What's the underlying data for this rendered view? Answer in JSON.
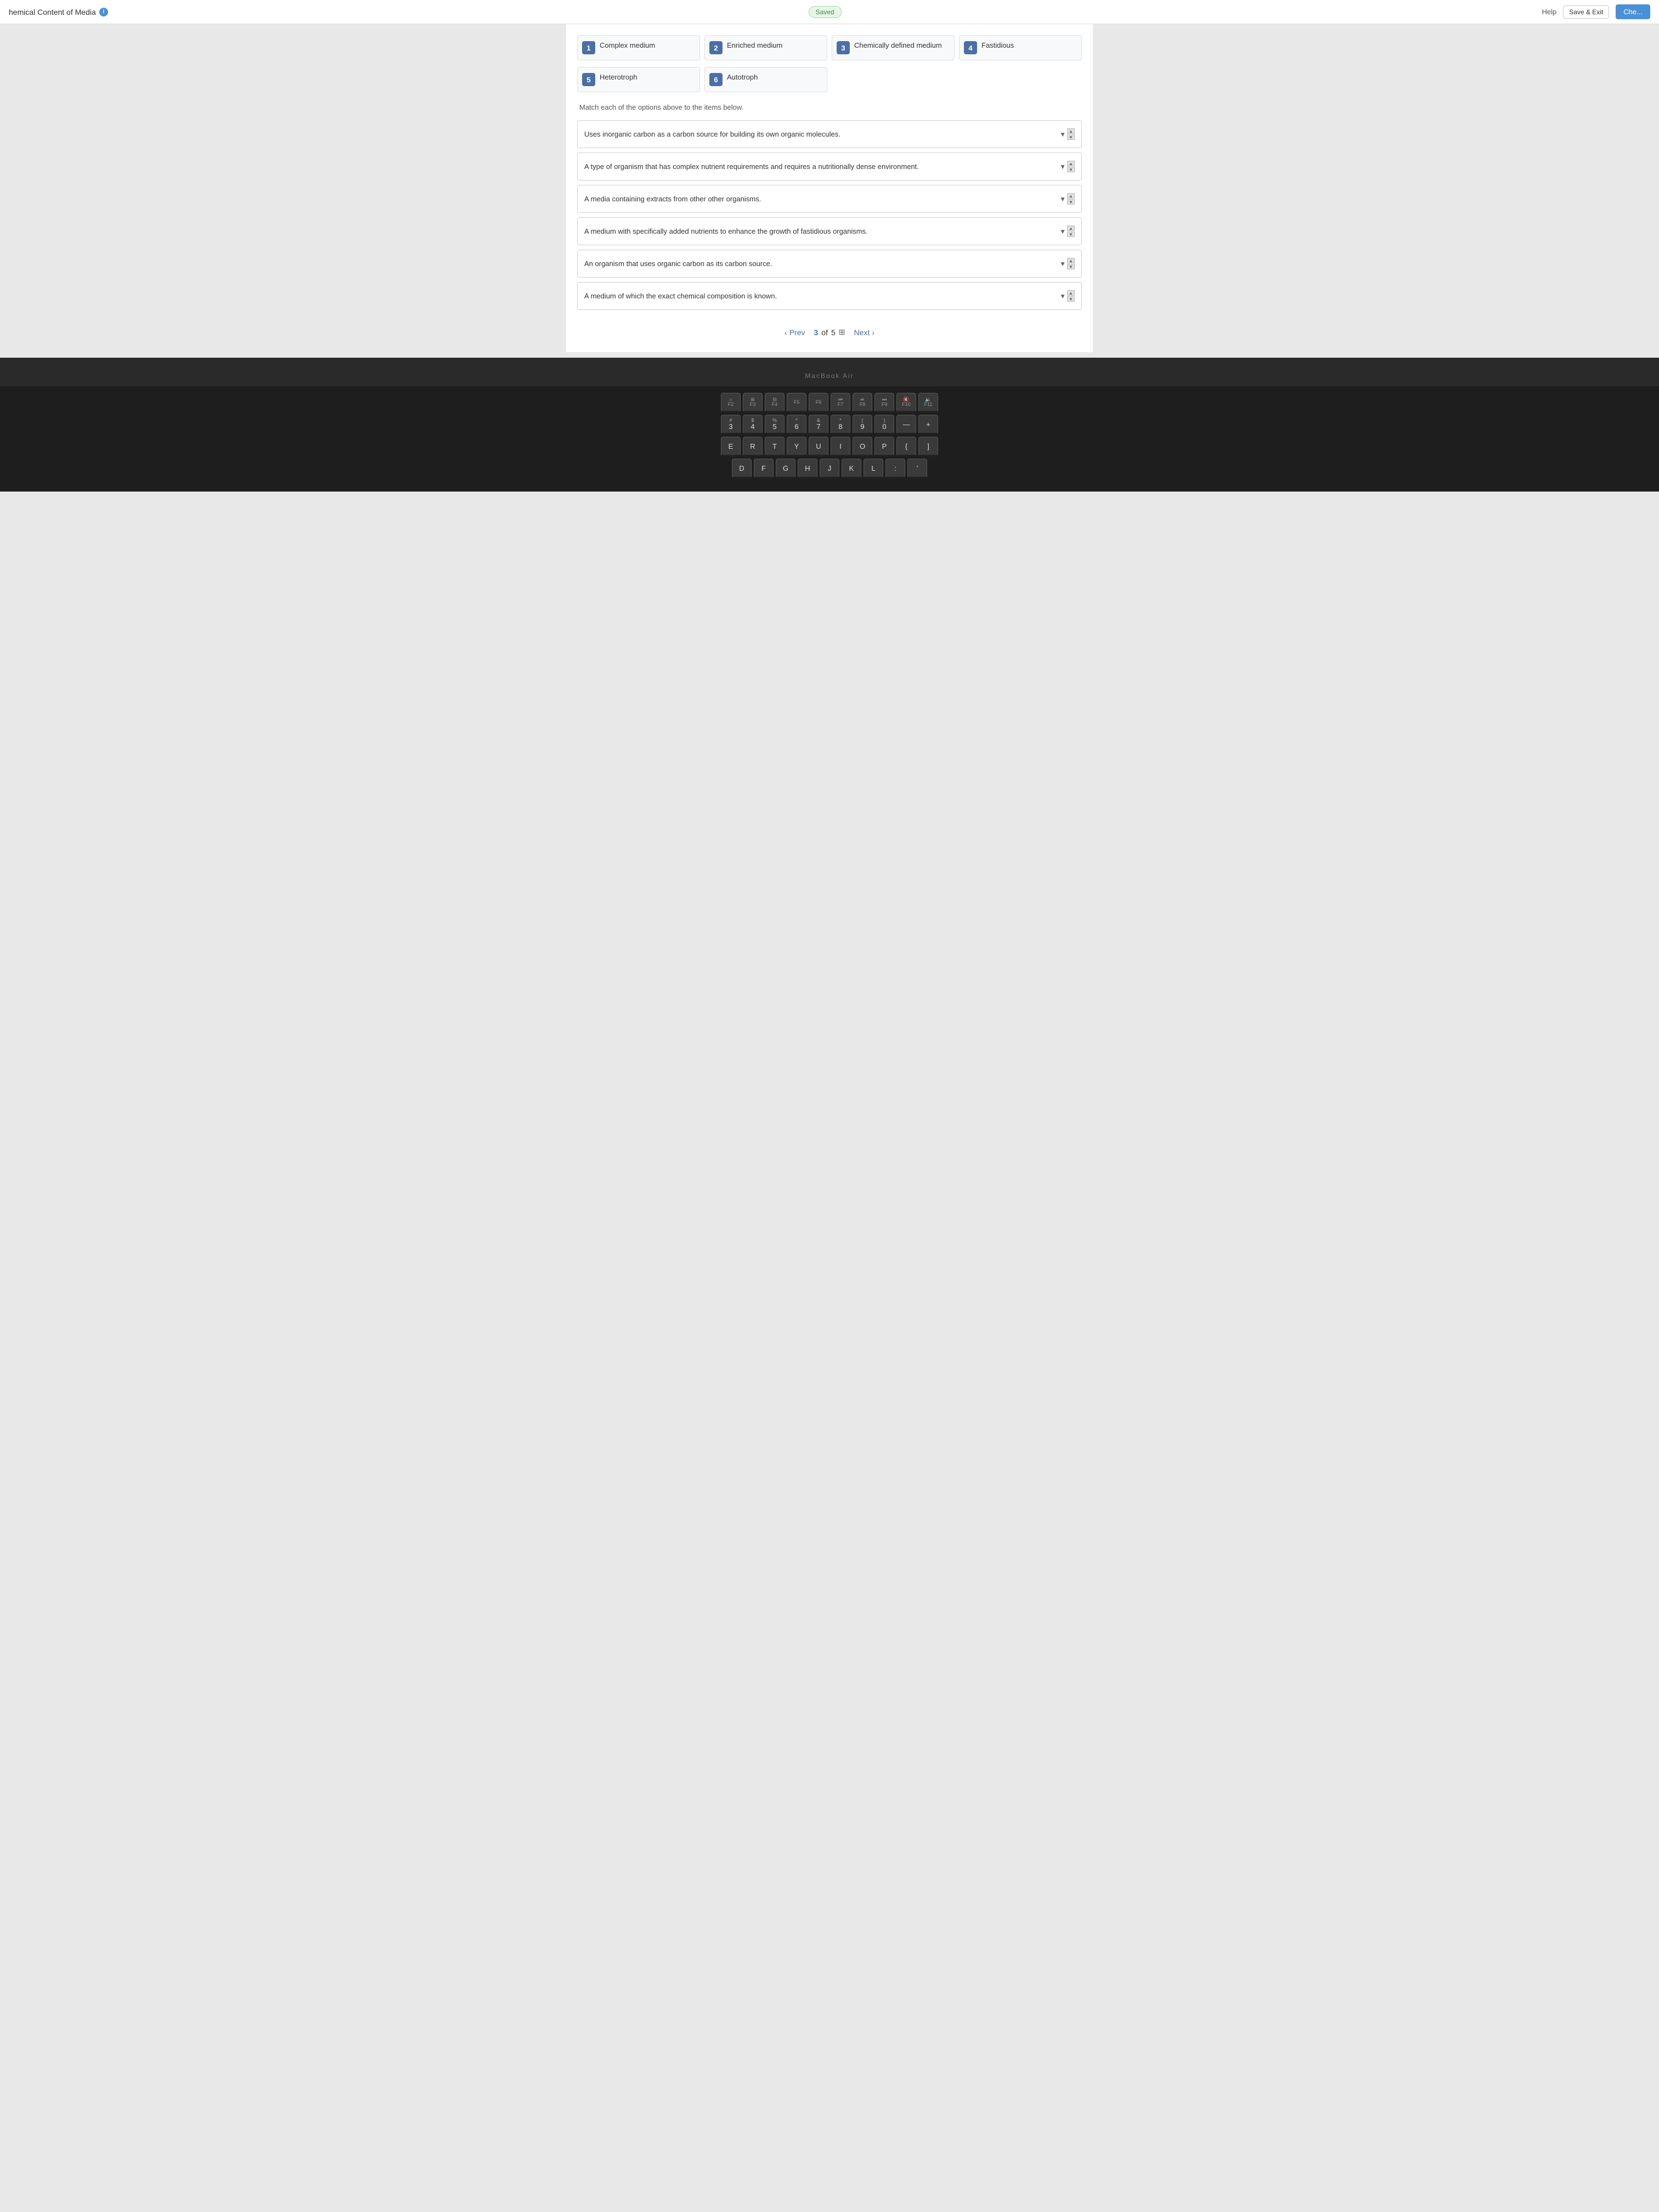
{
  "header": {
    "title": "hemical Content of Media",
    "info_label": "i",
    "saved_label": "Saved",
    "help_label": "Help",
    "save_exit_label": "Save & Exit",
    "check_label": "Che..."
  },
  "options": [
    {
      "number": "1",
      "label": "Complex medium"
    },
    {
      "number": "2",
      "label": "Enriched medium"
    },
    {
      "number": "3",
      "label": "Chemically defined medium"
    },
    {
      "number": "4",
      "label": "Fastidious"
    },
    {
      "number": "5",
      "label": "Heterotroph"
    },
    {
      "number": "6",
      "label": "Autotroph"
    }
  ],
  "instruction": "Match each of the options above to the items below.",
  "questions": [
    {
      "text": "Uses inorganic carbon as a carbon source for building its own organic molecules."
    },
    {
      "text": "A type of organism that has complex nutrient requirements and requires a nutritionally dense environment."
    },
    {
      "text": "A media containing extracts from other other organisms."
    },
    {
      "text": "A medium with specifically added nutrients to enhance the growth of fastidious organisms."
    },
    {
      "text": "An organism that uses organic carbon as its carbon source."
    },
    {
      "text": "A medium of which the exact chemical composition is known."
    }
  ],
  "pagination": {
    "prev_label": "Prev",
    "current": "3",
    "total": "5",
    "of_label": "of",
    "next_label": "Next"
  },
  "keyboard": {
    "rows": [
      [
        "F2",
        "F3",
        "F4",
        "F5",
        "F6",
        "F7",
        "F8",
        "F9",
        "F10",
        "F11"
      ],
      [
        "#3",
        "$4",
        "%5",
        "^6",
        "&7",
        "*8",
        "(9",
        ")0",
        "—",
        "+"
      ],
      [
        "E",
        "R",
        "T",
        "Y",
        "U",
        "I",
        "O",
        "P",
        "[",
        "]"
      ],
      [
        "D",
        "F",
        "G",
        "H",
        "J",
        "K",
        "L",
        ";",
        "'"
      ]
    ]
  },
  "macbook_label": "MacBook Air"
}
